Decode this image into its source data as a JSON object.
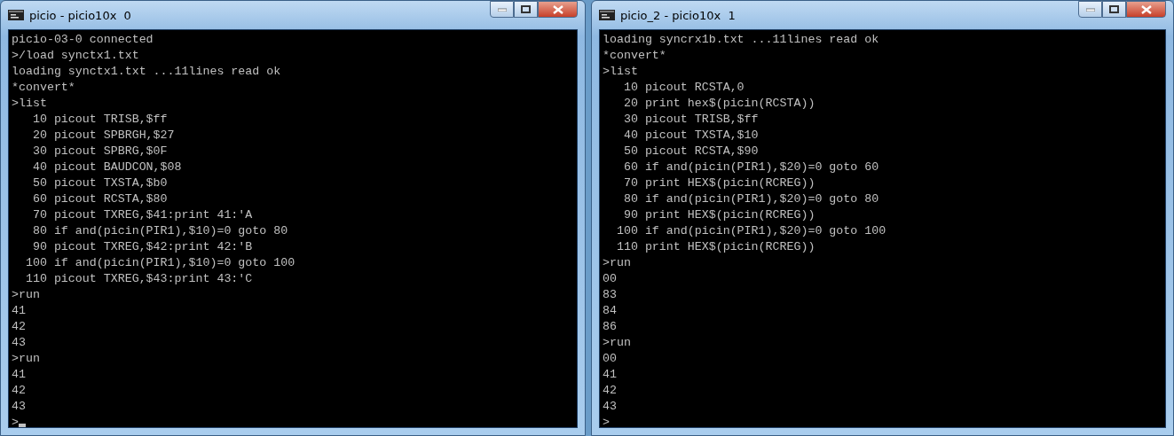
{
  "windows": [
    {
      "title": "picio - picio10x  0",
      "cursor": true,
      "lines": [
        "picio-03-0 connected",
        ">/load synctx1.txt",
        "loading synctx1.txt ...11lines read ok",
        "*convert*",
        ">list",
        "   10 picout TRISB,$ff",
        "   20 picout SPBRGH,$27",
        "   30 picout SPBRG,$0F",
        "   40 picout BAUDCON,$08",
        "   50 picout TXSTA,$b0",
        "   60 picout RCSTA,$80",
        "   70 picout TXREG,$41:print 41:'A",
        "   80 if and(picin(PIR1),$10)=0 goto 80",
        "   90 picout TXREG,$42:print 42:'B",
        "  100 if and(picin(PIR1),$10)=0 goto 100",
        "  110 picout TXREG,$43:print 43:'C",
        ">run",
        "41",
        "42",
        "43",
        ">run",
        "41",
        "42",
        "43",
        ">"
      ]
    },
    {
      "title": "picio_2 - picio10x  1",
      "cursor": false,
      "lines": [
        "loading syncrx1b.txt ...11lines read ok",
        "*convert*",
        ">list",
        "   10 picout RCSTA,0",
        "   20 print hex$(picin(RCSTA))",
        "   30 picout TRISB,$ff",
        "   40 picout TXSTA,$10",
        "   50 picout RCSTA,$90",
        "   60 if and(picin(PIR1),$20)=0 goto 60",
        "   70 print HEX$(picin(RCREG))",
        "   80 if and(picin(PIR1),$20)=0 goto 80",
        "   90 print HEX$(picin(RCREG))",
        "  100 if and(picin(PIR1),$20)=0 goto 100",
        "  110 print HEX$(picin(RCREG))",
        ">run",
        "00",
        "83",
        "84",
        "86",
        ">run",
        "00",
        "41",
        "42",
        "43",
        ">"
      ]
    }
  ]
}
